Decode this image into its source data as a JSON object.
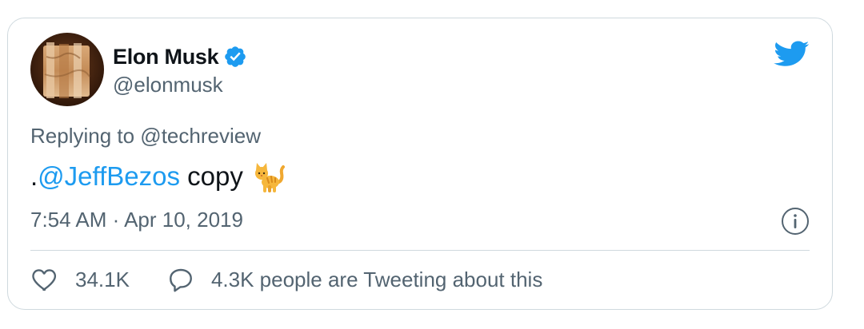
{
  "author": {
    "display_name": "Elon Musk",
    "handle": "@elonmusk",
    "verified": true
  },
  "reply_context": "Replying to @techreview",
  "tweet": {
    "prefix": ".",
    "mention": "@JeffBezos",
    "text": " copy",
    "emoji": "cat-emoji"
  },
  "timestamp": "7:54 AM · Apr 10, 2019",
  "actions": {
    "likes": "34.1K",
    "reply_label": "4.3K people are Tweeting about this"
  },
  "colors": {
    "accent": "#1d9bf0",
    "text": "#0f1419",
    "secondary": "#536471",
    "border": "#cfd9de"
  },
  "icons": [
    "verified-badge-icon",
    "twitter-bird-icon",
    "info-icon",
    "heart-icon",
    "speech-bubble-icon",
    "cat-emoji"
  ]
}
